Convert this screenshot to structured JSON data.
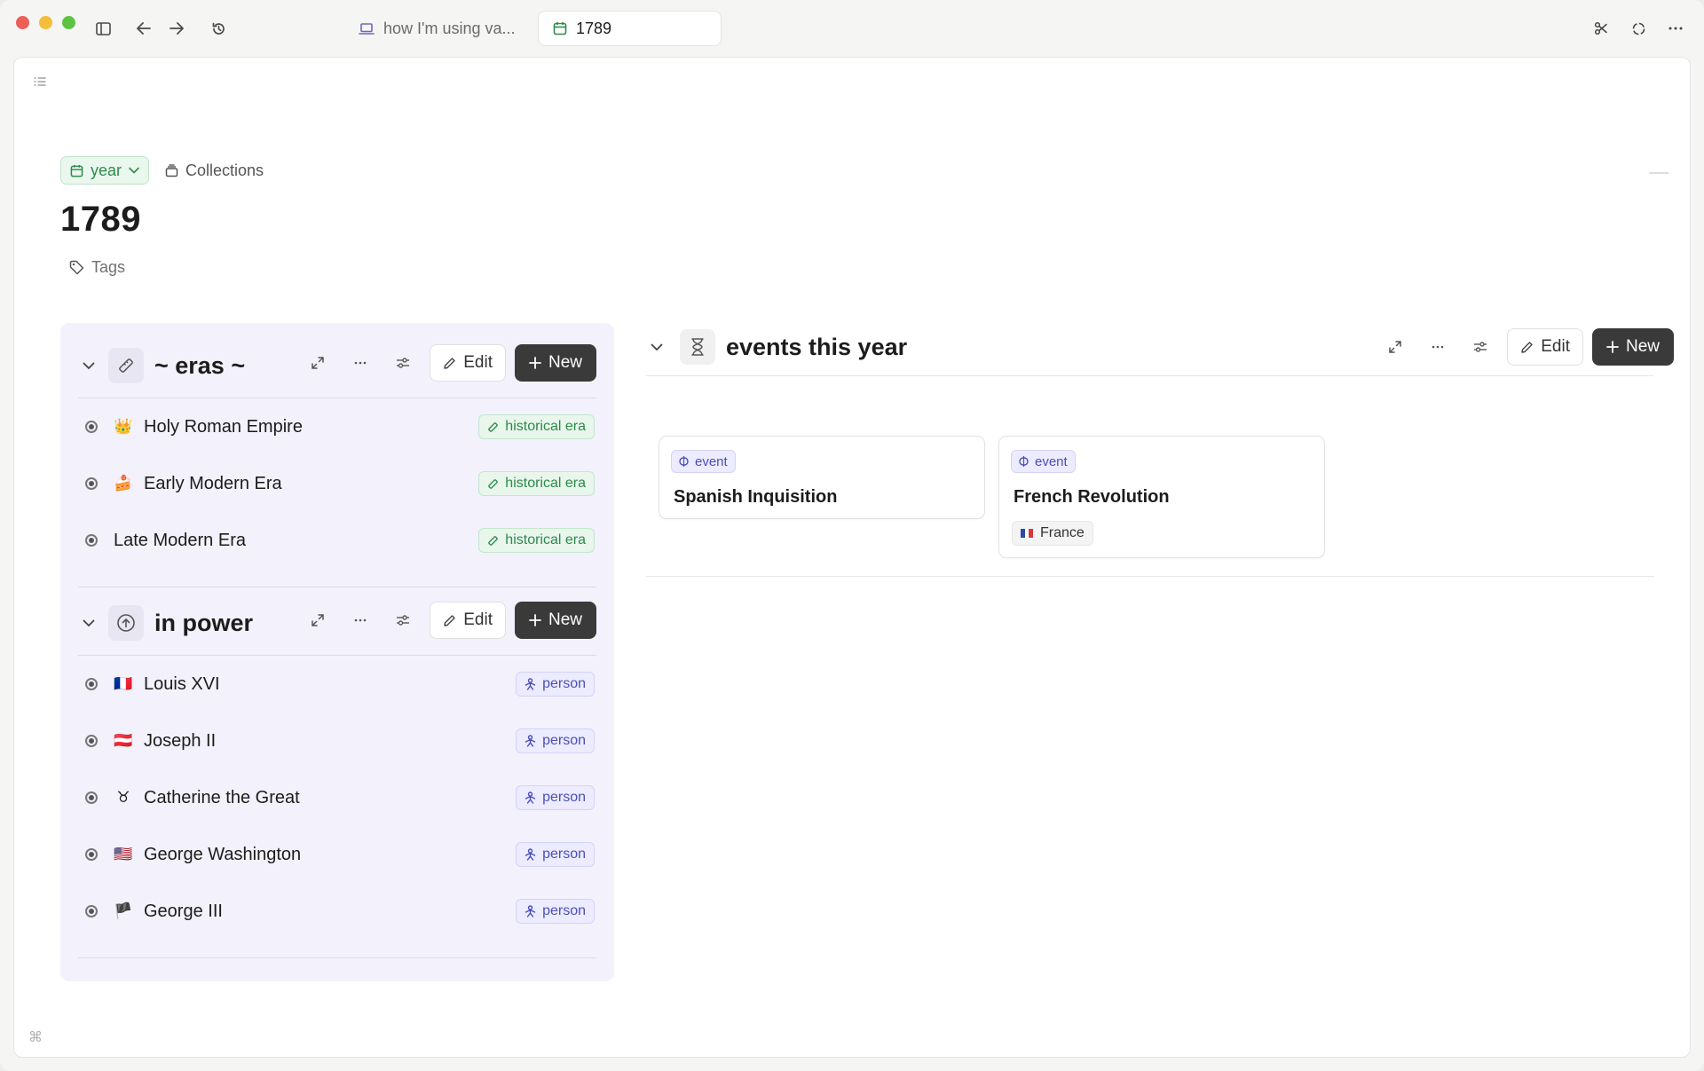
{
  "tabs": [
    {
      "label": "how I'm using va...",
      "active": false
    },
    {
      "label": "1789",
      "active": true
    }
  ],
  "breadcrumb": {
    "year_label": "year",
    "collections_label": "Collections"
  },
  "page": {
    "title": "1789",
    "tags_label": "Tags"
  },
  "eras": {
    "title": "~ eras ~",
    "edit_label": "Edit",
    "new_label": "New",
    "items": [
      {
        "emoji": "👑",
        "label": "Holy Roman Empire",
        "tag": "historical era"
      },
      {
        "emoji": "🍰",
        "label": "Early Modern Era",
        "tag": "historical era"
      },
      {
        "emoji": "",
        "label": "Late Modern Era",
        "tag": "historical era"
      }
    ]
  },
  "in_power": {
    "title": "in power",
    "edit_label": "Edit",
    "new_label": "New",
    "items": [
      {
        "emoji": "🇫🇷",
        "label": "Louis XVI",
        "tag": "person"
      },
      {
        "emoji": "🇦🇹",
        "label": "Joseph II",
        "tag": "person"
      },
      {
        "emoji": "♉",
        "label": "Catherine the Great",
        "tag": "person"
      },
      {
        "emoji": "🇺🇸",
        "label": "George Washington",
        "tag": "person"
      },
      {
        "emoji": "🏴",
        "label": "George III",
        "tag": "person"
      }
    ]
  },
  "events": {
    "title": "events this year",
    "edit_label": "Edit",
    "new_label": "New",
    "cards": [
      {
        "tag": "event",
        "title": "Spanish Inquisition"
      },
      {
        "tag": "event",
        "title": "French Revolution",
        "country": "France"
      }
    ]
  },
  "colors": {
    "accent_green": "#2d8a4b",
    "accent_purple": "#4b4fb8",
    "panel_bg": "#f3f1fb",
    "button_dark": "#3a3a3a"
  }
}
